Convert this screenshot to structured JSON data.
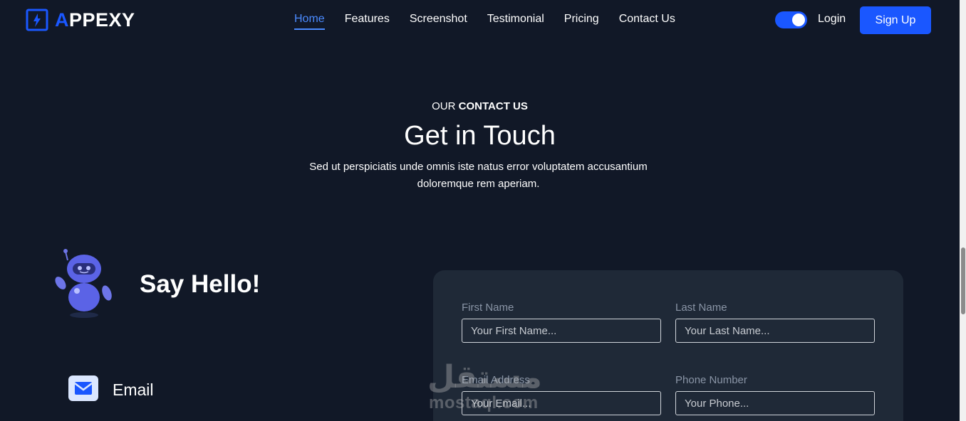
{
  "brand": {
    "logo_first_letter": "A",
    "logo_rest": "PPEXY",
    "accent": "#1a57ff",
    "background": "#111827"
  },
  "nav": {
    "items": [
      {
        "label": "Home",
        "active": true
      },
      {
        "label": "Features",
        "active": false
      },
      {
        "label": "Screenshot",
        "active": false
      },
      {
        "label": "Testimonial",
        "active": false
      },
      {
        "label": "Pricing",
        "active": false
      },
      {
        "label": "Contact Us",
        "active": false
      }
    ],
    "theme_toggle_on": true,
    "login_label": "Login",
    "signup_label": "Sign Up"
  },
  "section": {
    "eyebrow_prefix": "OUR ",
    "eyebrow_bold": "CONTACT US",
    "title": "Get in Touch",
    "description": "Sed ut perspiciatis unde omnis iste natus error voluptatem accusantium doloremque rem aperiam."
  },
  "left": {
    "say_hello": "Say Hello!",
    "email_heading": "Email"
  },
  "form": {
    "first_name": {
      "label": "First Name",
      "placeholder": "Your First Name..."
    },
    "last_name": {
      "label": "Last Name",
      "placeholder": "Your Last Name..."
    },
    "email": {
      "label": "Email Address",
      "placeholder": "Your Email..."
    },
    "phone": {
      "label": "Phone Number",
      "placeholder": "Your Phone..."
    }
  },
  "watermark": {
    "arabic": "مستقل",
    "latin": "mostaql.com"
  }
}
